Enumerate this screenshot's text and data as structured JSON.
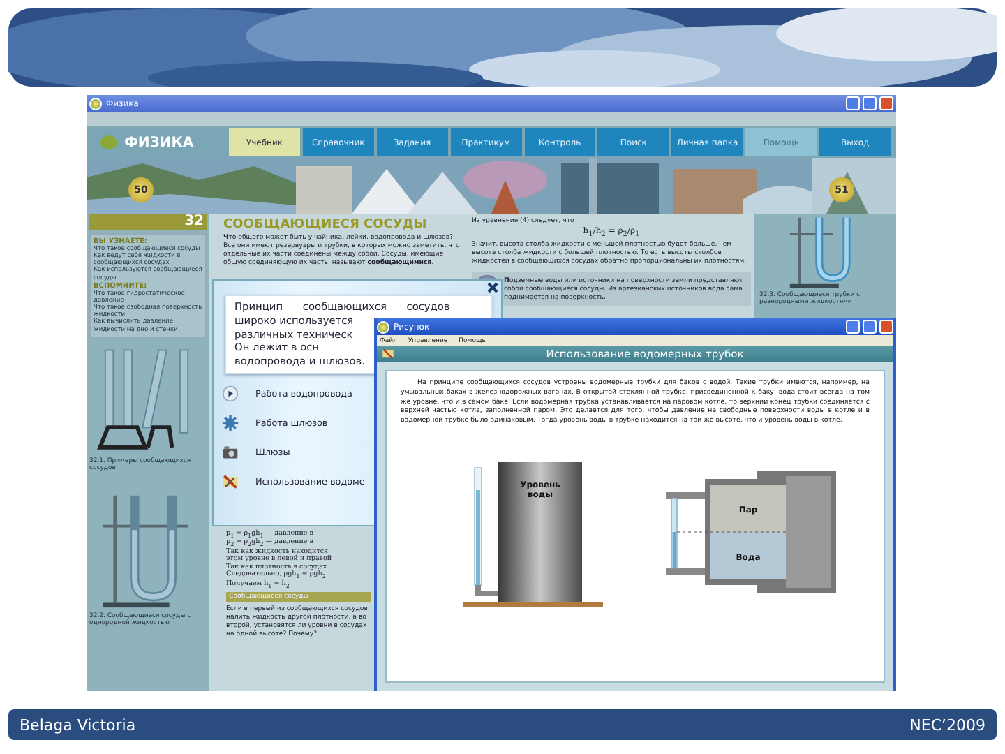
{
  "slide": {
    "author": "Belaga Victoria",
    "event": "NEC’2009"
  },
  "app": {
    "title": "Физика",
    "logo": "ФИЗИКА",
    "tabs": [
      {
        "label": "Учебник",
        "selected": true,
        "disabled": false
      },
      {
        "label": "Справочник",
        "selected": false,
        "disabled": false
      },
      {
        "label": "Задания",
        "selected": false,
        "disabled": false
      },
      {
        "label": "Практикум",
        "selected": false,
        "disabled": false
      },
      {
        "label": "Контроль",
        "selected": false,
        "disabled": false
      },
      {
        "label": "Поиск",
        "selected": false,
        "disabled": false
      },
      {
        "label": "Личная папка",
        "selected": false,
        "disabled": false
      },
      {
        "label": "Помощь",
        "selected": false,
        "disabled": true
      },
      {
        "label": "Выход",
        "selected": false,
        "disabled": false
      }
    ],
    "badges": [
      "50",
      "51"
    ]
  },
  "page": {
    "number": "32",
    "title": "СООБЩАЮЩИЕСЯ СОСУДЫ",
    "learn": {
      "heading": "ВЫ УЗНАЕТЕ:",
      "items": [
        "Что такое сообщающиеся сосуды",
        "Как ведут себя жидкости в сообщающихся сосудах",
        "Как используются сообщающиеся сосуды"
      ]
    },
    "recall": {
      "heading": "ВСПОМНИТЕ:",
      "items": [
        "Что такое гидростатическое давление",
        "Что такое свободная поверхность жидкости",
        "Как вычислить давление жидкости на дно и стенки"
      ]
    },
    "intro": "**Ч**то общего может быть у чайника, лейки, водопровода и шлюзов? Все они имеют резервуары и трубки, в которых можно заметить, что отдельные их части соединены между собой. Сосуды, имеющие общую соединяющую их часть, называют **сообщающимися**.",
    "right_intro": "Из уравнения (4) следует, что",
    "formula": "h$_{1}$/h$_{2}$ = ρ$_{2}$/ρ$_{1}$",
    "right_text": "Значит, высота столба жидкости с меньшей плотностью будет больше, чем высота столба жидкости с большей плотностью. То есть высоты столбов жидкостей в сообщающихся сосудах обратно пропорциональны их плотностям.",
    "note": "**П**одземные воды или источники на поверхности земли представляют собой сообщающиеся сосуды. Из артезианских источников вода сама поднимается на поверхность.",
    "left_captions": [
      "32.1. Примеры сообщающихся сосудов",
      "32.2. Сообщающиеся сосуды с однородной жидкостью"
    ],
    "right_caption": "32.3. Сообщающиеся трубки с разнородными жидкостями",
    "lower_lines": [
      "p$_{1}$ = ρ$_{1}$gh$_{1}$ — давление в",
      "p$_{2}$ = ρ$_{2}$gh$_{2}$ — давление в",
      "Так как жидкость находится",
      "этом уровне в левой и правой",
      "Так как плотность в сосудах",
      "Следовательно, ρgh$_{1}$ = ρgh$_{2}$",
      "Получаем h$_{1}$ = h$_{2}$"
    ],
    "section_bar": "Сообщающиеся сосуды",
    "question": "Если в первый из сообщающихся сосудов налить жидкость другой плотности, а во второй, установятся ли уровни в сосудах на одной высоте? Почему?"
  },
  "popup": {
    "lines": [
      "Принцип сообщающихся сосудов",
      "широко используется",
      "различных техническ",
      "Он лежит в осн",
      "водопровода и шлюзов."
    ],
    "items": [
      {
        "label": "Работа водопровода",
        "kind": "play"
      },
      {
        "label": "Работа шлюзов",
        "kind": "gear"
      },
      {
        "label": "Шлюзы",
        "kind": "camera"
      },
      {
        "label": "Использование водоме",
        "kind": "tools"
      }
    ]
  },
  "figure_window": {
    "title": "Рисунок",
    "menu": [
      "Файл",
      "Управление",
      "Помощь"
    ],
    "heading": "Использование водомерных трубок",
    "text": "На принципе сообщающихся сосудов устроены водомерные трубки для баков с водой. Такие трубки имеются, например, на умывальных баках в железнодорожных вагонах. В открытой стеклянной трубке, присоединенной к баку, вода стоит всегда на том же уровне, что и в самом баке. Если водомерная трубка устанавливается на паровом котле, то верхний конец трубки соединяется с верхней частью котла, заполненной паром. Это делается для того, чтобы давление на свободные поверхности воды в котле и в водомерной трубке было одинаковым. Тогда уровень воды в трубке находится на той же высоте, что и уровень воды в котле.",
    "labels": {
      "level_top": "Уровень",
      "level_bottom": "воды",
      "steam": "Пар",
      "water": "Вода"
    }
  }
}
